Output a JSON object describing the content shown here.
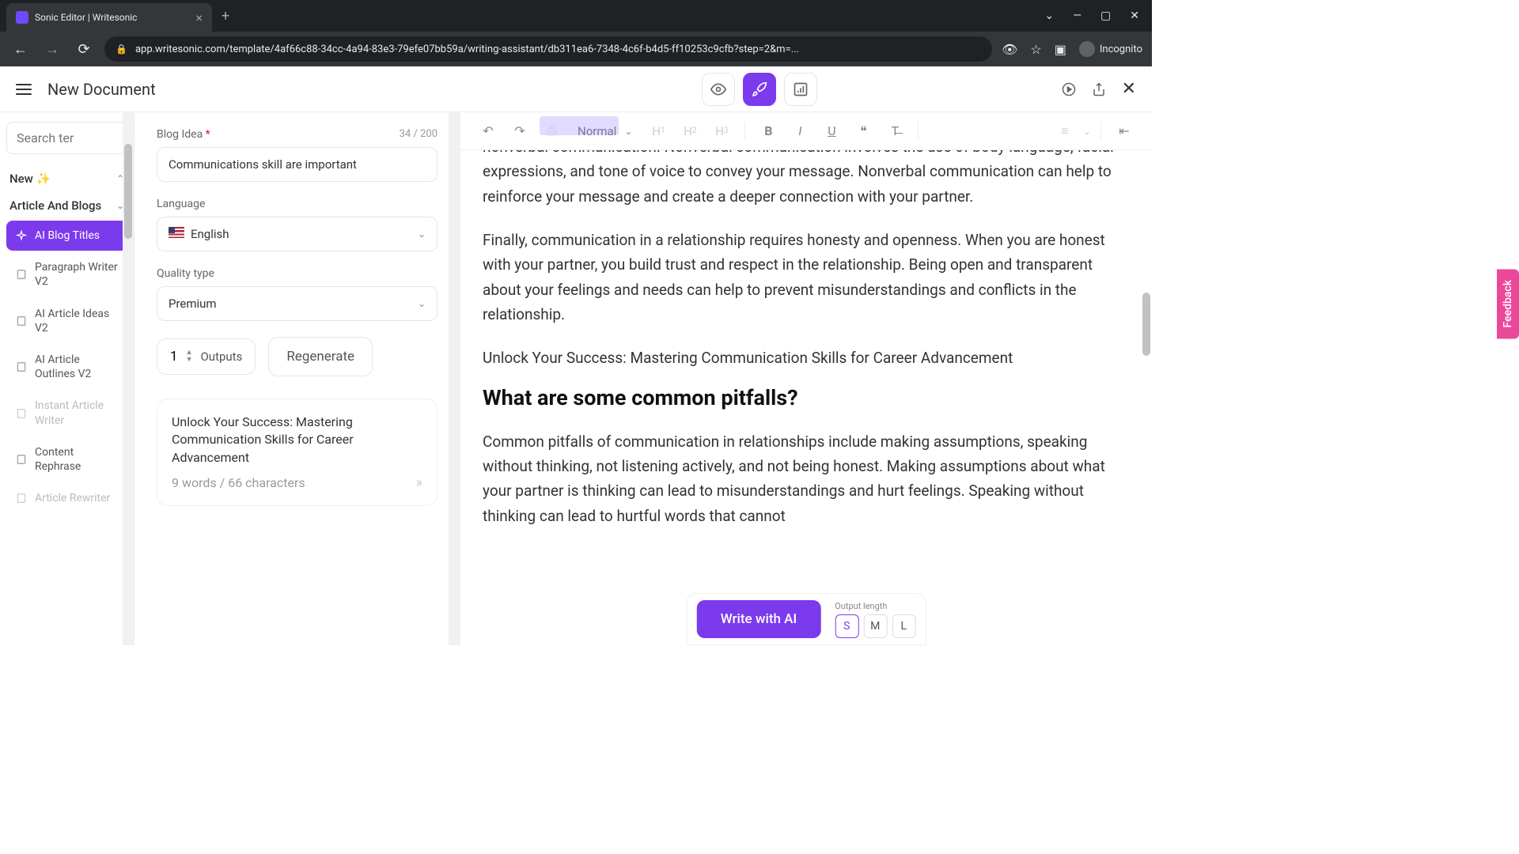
{
  "browser": {
    "tab_title": "Sonic Editor | Writesonic",
    "url": "app.writesonic.com/template/4af66c88-34cc-4a94-83e3-79efe07bb59a/writing-assistant/db311ea6-7348-4c6f-b4d5-ff10253c9cfb?step=2&m=...",
    "incognito": "Incognito"
  },
  "header": {
    "doc_title": "New Document"
  },
  "sidebar": {
    "search_placeholder": "Search ter",
    "new_label": "New ✨",
    "category": "Article And Blogs",
    "items": [
      "AI Blog Titles",
      "Paragraph Writer V2",
      "AI Article Ideas V2",
      "AI Article Outlines V2",
      "Instant Article Writer",
      "Content Rephrase",
      "Article Rewriter"
    ]
  },
  "form": {
    "blog_idea_label": "Blog Idea",
    "blog_idea_count": "34 / 200",
    "blog_idea_value": "Communications skill are important",
    "language_label": "Language",
    "language_value": "English",
    "quality_label": "Quality type",
    "quality_value": "Premium",
    "outputs_value": "1",
    "outputs_label": "Outputs",
    "regenerate": "Regenerate",
    "result_title": "Unlock Your Success: Mastering Communication Skills for Career Advancement",
    "result_meta": "9 words / 66 characters"
  },
  "toolbar": {
    "style": "Normal"
  },
  "editor": {
    "p1": "nonverbal communication. Nonverbal communication involves the use of body language, facial expressions, and tone of voice to convey your message. Nonverbal communication can help to reinforce your message and create a deeper connection with your partner.",
    "p2": "Finally, communication in a relationship requires honesty and openness. When you are honest with your partner, you build trust and respect in the relationship. Being open and transparent about your feelings and needs can help to prevent misunderstandings and conflicts in the relationship.",
    "p3": "Unlock Your Success: Mastering Communication Skills for Career Advancement",
    "h2": "What are some common pitfalls?",
    "p4": "Common pitfalls of communication in relationships include making assumptions, speaking without thinking, not listening actively, and not being honest. Making assumptions about what your partner is thinking can lead to misunderstandings and hurt feelings. Speaking without thinking can lead to hurtful words that cannot"
  },
  "bottom": {
    "write_ai": "Write with AI",
    "output_length_label": "Output length",
    "s": "S",
    "m": "M",
    "l": "L"
  },
  "feedback": "Feedback"
}
